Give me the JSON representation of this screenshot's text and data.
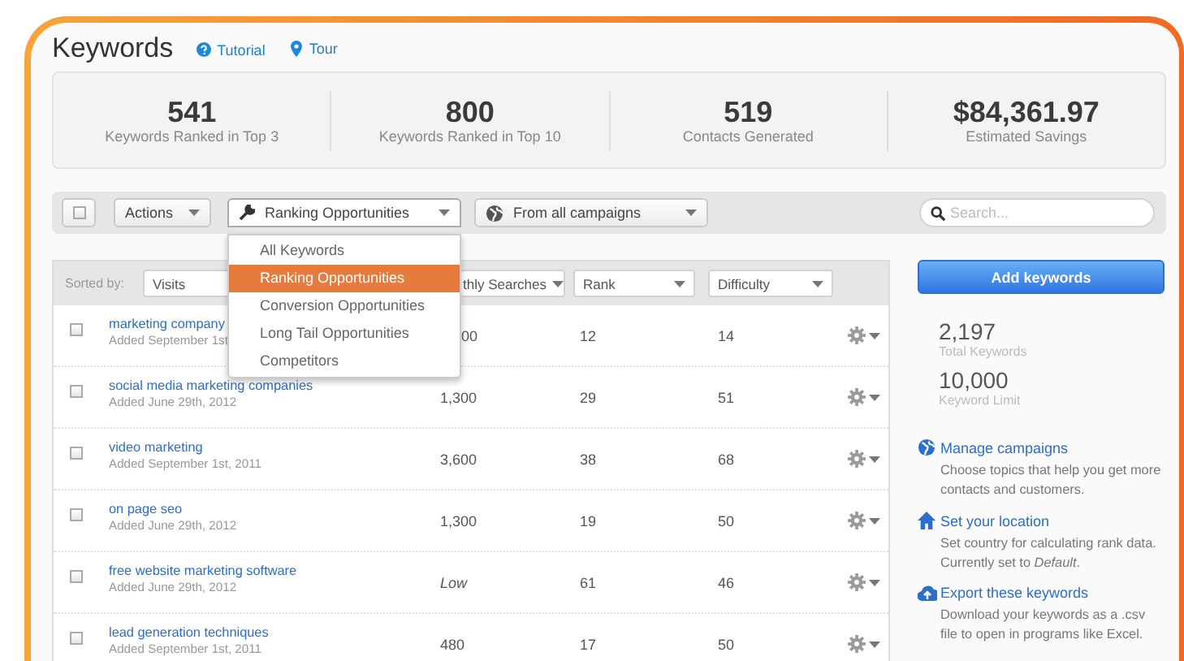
{
  "header": {
    "title": "Keywords",
    "links": [
      {
        "label": "Tutorial",
        "kind": "help"
      },
      {
        "label": "Tour",
        "kind": "pin"
      }
    ]
  },
  "stats": [
    {
      "value": "541",
      "label": "Keywords Ranked in Top 3"
    },
    {
      "value": "800",
      "label": "Keywords Ranked in Top 10"
    },
    {
      "value": "519",
      "label": "Contacts Generated"
    },
    {
      "value": "$84,361.97",
      "label": "Estimated Savings"
    }
  ],
  "toolbar": {
    "select_all": {
      "checked": false
    },
    "actions": "Actions",
    "filter": {
      "value": "Ranking Opportunities",
      "expanded": true
    },
    "campaigns": "From all campaigns",
    "search": {
      "placeholder": "Search..."
    }
  },
  "filter_menu": [
    {
      "label": "All Keywords",
      "selected": false
    },
    {
      "label": "Ranking Opportunities",
      "selected": true
    },
    {
      "label": "Conversion Opportunities",
      "selected": false
    },
    {
      "label": "Long Tail Opportunities",
      "selected": false
    },
    {
      "label": "Competitors",
      "selected": false
    }
  ],
  "sort_bar": {
    "label": "Sorted by:",
    "sorts": [
      "Visits",
      "thly Searches",
      "Rank",
      "Difficulty"
    ]
  },
  "rows": [
    {
      "checked": false,
      "keyword": "marketing company",
      "added": "Added September 1st",
      "searches": "00",
      "estimated": false,
      "covered": true,
      "rank": "12",
      "difficulty": "14"
    },
    {
      "checked": false,
      "keyword": "social media marketing companies",
      "added": "Added June 29th, 2012",
      "searches": "1,300",
      "estimated": false,
      "covered": false,
      "rank": "29",
      "difficulty": "51"
    },
    {
      "checked": false,
      "keyword": "video marketing",
      "added": "Added September 1st, 2011",
      "searches": "3,600",
      "estimated": false,
      "covered": false,
      "rank": "38",
      "difficulty": "68"
    },
    {
      "checked": false,
      "keyword": "on page seo",
      "added": "Added June 29th, 2012",
      "searches": "1,300",
      "estimated": false,
      "covered": false,
      "rank": "19",
      "difficulty": "50"
    },
    {
      "checked": false,
      "keyword": "free website marketing software",
      "added": "Added June 29th, 2012",
      "searches": "Low",
      "estimated": true,
      "covered": false,
      "rank": "61",
      "difficulty": "46"
    },
    {
      "checked": false,
      "keyword": "lead generation techniques",
      "added": "Added September 1st, 2011",
      "searches": "480",
      "estimated": false,
      "covered": false,
      "rank": "17",
      "difficulty": "50"
    }
  ],
  "sidebar": {
    "add_button": "Add keywords",
    "totals": [
      {
        "value": "2,197",
        "label": "Total Keywords"
      },
      {
        "value": "10,000",
        "label": "Keyword Limit"
      }
    ],
    "actions": [
      {
        "kind": "globe",
        "title": "Manage campaigns",
        "text": "Choose topics that help you get more contacts and customers."
      },
      {
        "kind": "home",
        "title": "Set your location",
        "text": "Set country for calculating rank data. Currently set to *Default*."
      },
      {
        "kind": "export",
        "title": "Export these keywords",
        "text": "Download your keywords as a .csv file to open in programs like Excel."
      }
    ]
  }
}
